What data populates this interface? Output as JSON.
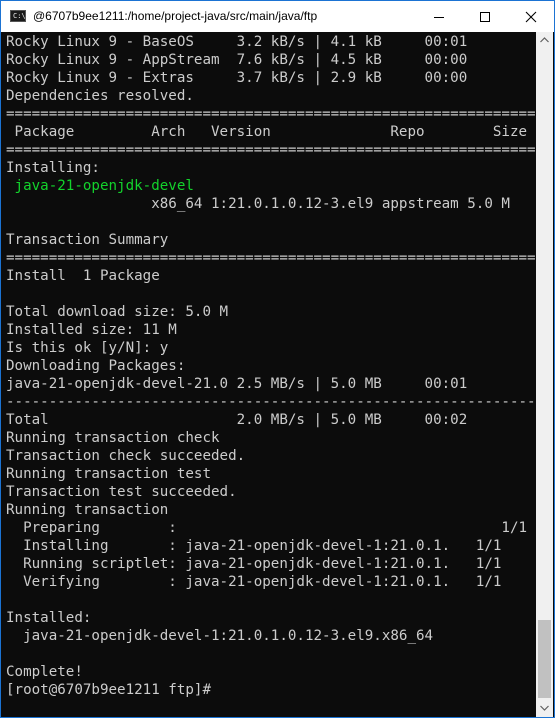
{
  "window": {
    "title": "@6707b9ee1211:/home/project-java/src/main/java/ftp",
    "app_icon_text": "C:\\"
  },
  "colors": {
    "terminal_bg": "#0c0c0c",
    "terminal_fg": "#cccccc",
    "highlight_green": "#13d32c",
    "window_border": "#1b73d3"
  },
  "terminal": {
    "lines": [
      "Rocky Linux 9 - BaseOS     3.2 kB/s | 4.1 kB     00:01",
      "Rocky Linux 9 - AppStream  7.6 kB/s | 4.5 kB     00:00",
      "Rocky Linux 9 - Extras     3.7 kB/s | 2.9 kB     00:00",
      "Dependencies resolved.",
      "=================================================================",
      " Package         Arch   Version              Repo        Size",
      "=================================================================",
      "Installing:",
      " java-21-openjdk-devel",
      "                 x86_64 1:21.0.1.0.12-3.el9 appstream 5.0 M",
      "",
      "Transaction Summary",
      "=================================================================",
      "Install  1 Package",
      "",
      "Total download size: 5.0 M",
      "Installed size: 11 M",
      "Is this ok [y/N]: y",
      "Downloading Packages:",
      "java-21-openjdk-devel-21.0 2.5 MB/s | 5.0 MB     00:01",
      "-----------------------------------------------------------------",
      "Total                      2.0 MB/s | 5.0 MB     00:02",
      "Running transaction check",
      "Transaction check succeeded.",
      "Running transaction test",
      "Transaction test succeeded.",
      "Running transaction",
      "  Preparing        :                                      1/1",
      "  Installing       : java-21-openjdk-devel-1:21.0.1.   1/1",
      "  Running scriptlet: java-21-openjdk-devel-1:21.0.1.   1/1",
      "  Verifying        : java-21-openjdk-devel-1:21.0.1.   1/1",
      "",
      "Installed:",
      "  java-21-openjdk-devel-1:21.0.1.0.12-3.el9.x86_64",
      "",
      "Complete!",
      "[root@6707b9ee1211 ftp]#"
    ],
    "green_line_indexes": [
      8
    ]
  }
}
